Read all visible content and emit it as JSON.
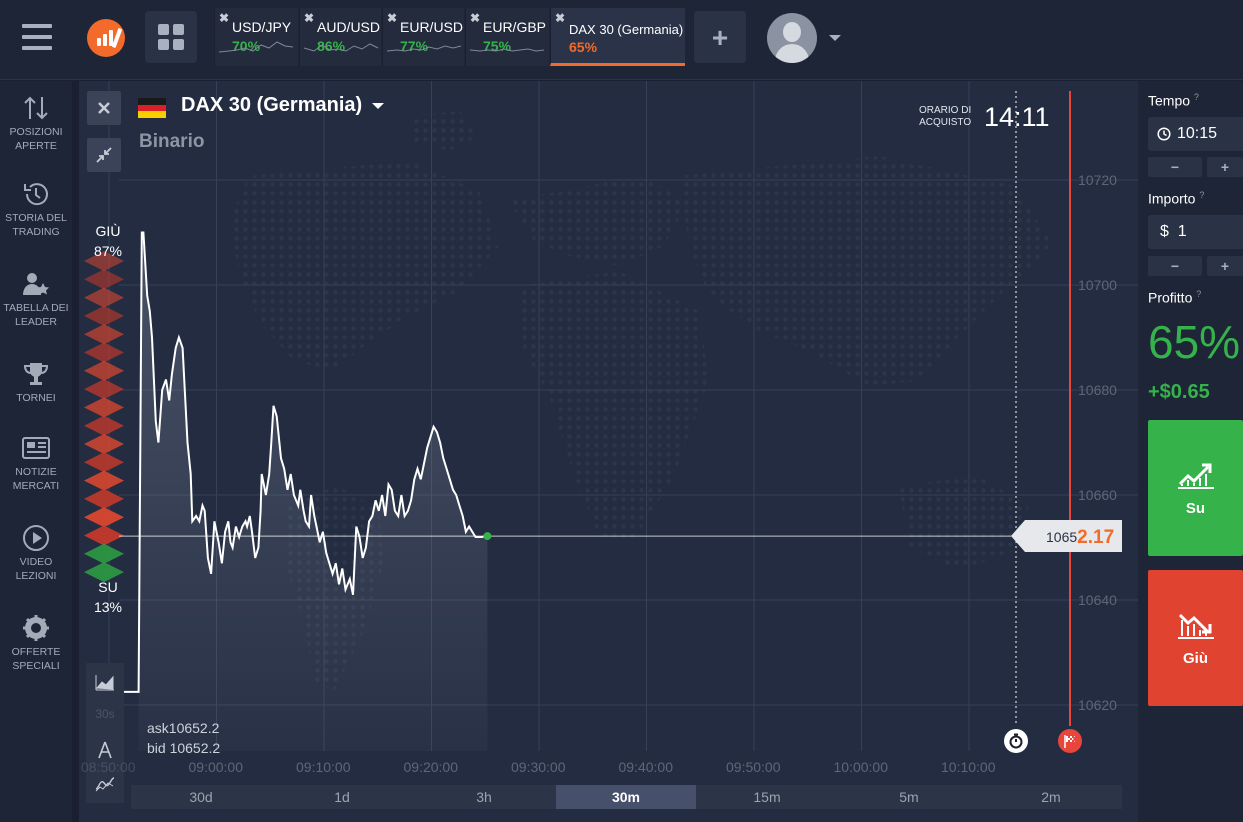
{
  "tabs": [
    {
      "name": "USD/JPY",
      "percent": "70%"
    },
    {
      "name": "AUD/USD",
      "percent": "86%"
    },
    {
      "name": "EUR/USD",
      "percent": "77%"
    },
    {
      "name": "EUR/GBP",
      "percent": "75%"
    },
    {
      "name": "DAX 30 (Germania)",
      "percent": "65%",
      "active": true
    }
  ],
  "sidebar": {
    "items": [
      {
        "icon": "arrows-updown-icon",
        "label": "POSIZIONI APERTE"
      },
      {
        "icon": "history-icon",
        "label": "STORIA DEL TRADING"
      },
      {
        "icon": "leaderboard-icon",
        "label": "TABELLA DEI LEADER"
      },
      {
        "icon": "trophy-icon",
        "label": "TORNEI"
      },
      {
        "icon": "newspaper-icon",
        "label": "NOTIZIE MERCATI"
      },
      {
        "icon": "play-icon",
        "label": "VIDEO LEZIONI"
      },
      {
        "icon": "gift-gear-icon",
        "label": "OFFERTE SPECIALI"
      }
    ]
  },
  "asset": {
    "title": "DAX 30 (Germania)",
    "subtitle": "Binario"
  },
  "purchase_time": {
    "label_line1": "ORARIO DI",
    "label_line2": "ACQUISTO",
    "value": "14:11"
  },
  "sentiment": {
    "down_label": "GIÙ",
    "down_pct": "87%",
    "up_label": "SU",
    "up_pct": "13%"
  },
  "quote": {
    "ask": "ask10652.2",
    "bid": "bid 10652.2",
    "price_prefix": "1065",
    "price_suffix": "2.17"
  },
  "timeframes": [
    "30d",
    "1d",
    "3h",
    "30m",
    "15m",
    "5m",
    "2m"
  ],
  "active_timeframe": "30m",
  "overlay_label": "30s",
  "right_panel": {
    "tempo_label": "Tempo",
    "tempo_value": "10:15",
    "importo_label": "Importo",
    "importo_value": "$  1",
    "profitto_label": "Profitto",
    "profit_pct": "65%",
    "profit_amount": "+$0.65",
    "minus": "−",
    "plus": "+",
    "up_button": "Su",
    "down_button": "Giù"
  },
  "colors": {
    "up": "#35b34a",
    "down": "#e0432f",
    "accent": "#f26b2a"
  },
  "chart_data": {
    "type": "line",
    "yticks": [
      "10720",
      "10700",
      "10680",
      "10660",
      "10640",
      "10620"
    ],
    "ylim": [
      10615,
      10730
    ],
    "xticks": [
      "08:50:00",
      "09:00:00",
      "09:10:00",
      "09:20:00",
      "09:30:00",
      "09:40:00",
      "09:50:00",
      "10:00:00",
      "10:10:00"
    ],
    "x_minutes": [
      0,
      2.75,
      3.05,
      3.2,
      3.55,
      3.8,
      4.0,
      4.35,
      4.6,
      4.95,
      5.3,
      5.6,
      5.85,
      6.2,
      6.5,
      6.85,
      7.3,
      7.6,
      7.75,
      8.1,
      8.4,
      8.7,
      8.9,
      9.2,
      9.5,
      9.8,
      10.2,
      10.5,
      10.8,
      11.1,
      11.3,
      11.5,
      11.8,
      12.1,
      12.4,
      12.7,
      12.85,
      13.1,
      13.3,
      13.6,
      13.9,
      14.1,
      14.2,
      14.6,
      14.9,
      15.1,
      15.3,
      15.6,
      16.0,
      16.3,
      16.6,
      16.9,
      17.2,
      17.6,
      17.8,
      18.1,
      18.3,
      18.6,
      18.8,
      19.1,
      19.3,
      19.6,
      19.9,
      20.2,
      20.5,
      20.8,
      21.1,
      21.4,
      21.7,
      22.0,
      22.4,
      22.7,
      23.0,
      23.3,
      23.6,
      23.9,
      24.2,
      24.5,
      24.8,
      25.1,
      25.4,
      25.7,
      26.0,
      26.3,
      26.6,
      26.9,
      27.2,
      27.5,
      27.8,
      28.1,
      28.4,
      28.7,
      29.0,
      29.3,
      29.6,
      29.9,
      30.2,
      30.5,
      30.8,
      31.1,
      31.4,
      31.7,
      32.0,
      32.3,
      32.6,
      32.9,
      33.2,
      33.5,
      33.8,
      34.1,
      34.4,
      34.7,
      35.0,
      35.2
    ],
    "values": [
      10622.5,
      10622.5,
      10710,
      10710,
      10698,
      10695,
      10690,
      10674,
      10670,
      10680,
      10682,
      10678,
      10683,
      10688,
      10690,
      10688,
      10670,
      10664,
      10655,
      10656,
      10655,
      10658,
      10657,
      10648,
      10645,
      10655,
      10651,
      10647,
      10653,
      10655,
      10651,
      10650,
      10654,
      10652,
      10654,
      10655,
      10654,
      10656,
      10653,
      10648,
      10650,
      10657,
      10664,
      10660,
      10664,
      10670,
      10677,
      10675,
      10667,
      10665,
      10661,
      10664,
      10660,
      10658,
      10661,
      10657,
      10655,
      10654,
      10660,
      10656,
      10654,
      10651,
      10653,
      10649,
      10647,
      10645,
      10647,
      10643,
      10646,
      10642,
      10644,
      10641,
      10654,
      10652,
      10648,
      10650,
      10655,
      10656,
      10659,
      10657,
      10660,
      10656,
      10662,
      10661,
      10657,
      10656,
      10660,
      10656,
      10657,
      10659,
      10663,
      10665,
      10663,
      10666,
      10669,
      10671,
      10673,
      10672,
      10670,
      10667,
      10665,
      10663,
      10661,
      10660,
      10658,
      10656,
      10653,
      10654,
      10653,
      10652,
      10652,
      10652,
      10652.17,
      10652.17
    ],
    "current_price": 10652.17
  }
}
